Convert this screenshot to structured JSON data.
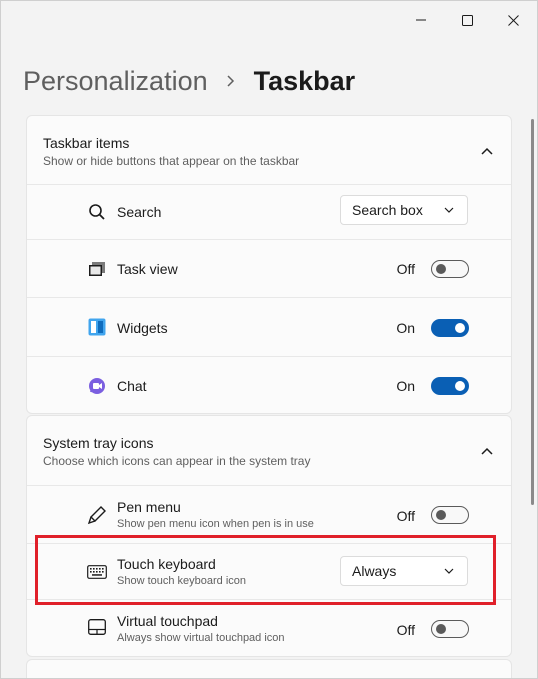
{
  "window": {
    "controls": {
      "minimize": "minimize-icon",
      "maximize": "maximize-icon",
      "close": "close-icon"
    }
  },
  "breadcrumb": {
    "parent": "Personalization",
    "current": "Taskbar"
  },
  "taskbar_items": {
    "title": "Taskbar items",
    "subtitle": "Show or hide buttons that appear on the taskbar",
    "items": [
      {
        "label": "Search",
        "icon": "search-icon",
        "control": "dropdown",
        "value": "Search box"
      },
      {
        "label": "Task view",
        "icon": "task-view-icon",
        "control": "toggle",
        "state": "Off"
      },
      {
        "label": "Widgets",
        "icon": "widgets-icon",
        "control": "toggle",
        "state": "On"
      },
      {
        "label": "Chat",
        "icon": "chat-icon",
        "control": "toggle",
        "state": "On"
      }
    ]
  },
  "system_tray": {
    "title": "System tray icons",
    "subtitle": "Choose which icons can appear in the system tray",
    "items": [
      {
        "label": "Pen menu",
        "desc": "Show pen menu icon when pen is in use",
        "icon": "pen-icon",
        "control": "toggle",
        "state": "Off"
      },
      {
        "label": "Touch keyboard",
        "desc": "Show touch keyboard icon",
        "icon": "keyboard-icon",
        "control": "dropdown",
        "value": "Always"
      },
      {
        "label": "Virtual touchpad",
        "desc": "Always show virtual touchpad icon",
        "icon": "touchpad-icon",
        "control": "toggle",
        "state": "Off"
      }
    ]
  },
  "colors": {
    "accent": "#0a5fb4",
    "highlight": "#e0202a"
  }
}
